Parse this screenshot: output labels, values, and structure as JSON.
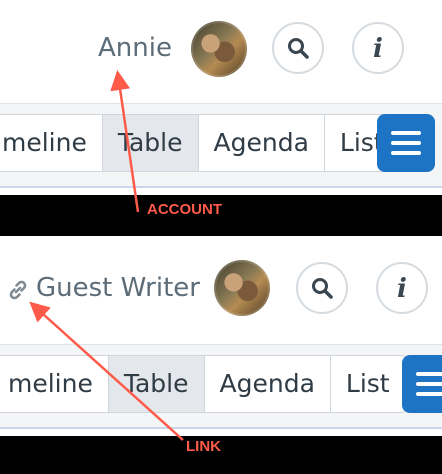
{
  "top": {
    "account_name": "Annie",
    "tabs": [
      "meline",
      "Table",
      "Agenda",
      "List"
    ],
    "active_tab": "Table",
    "annotation": "ACCOUNT"
  },
  "bottom": {
    "account_name": "Guest Writer",
    "tabs": [
      "meline",
      "Table",
      "Agenda",
      "List"
    ],
    "active_tab": "Table",
    "annotation": "LINK"
  },
  "icons": {
    "search": "search-icon",
    "info": "info-icon",
    "menu": "hamburger-menu-icon",
    "link": "link-icon"
  },
  "colors": {
    "annotation": "#ff5a4a",
    "menu_button": "#1d73c4",
    "name_text": "#5c6c78"
  }
}
